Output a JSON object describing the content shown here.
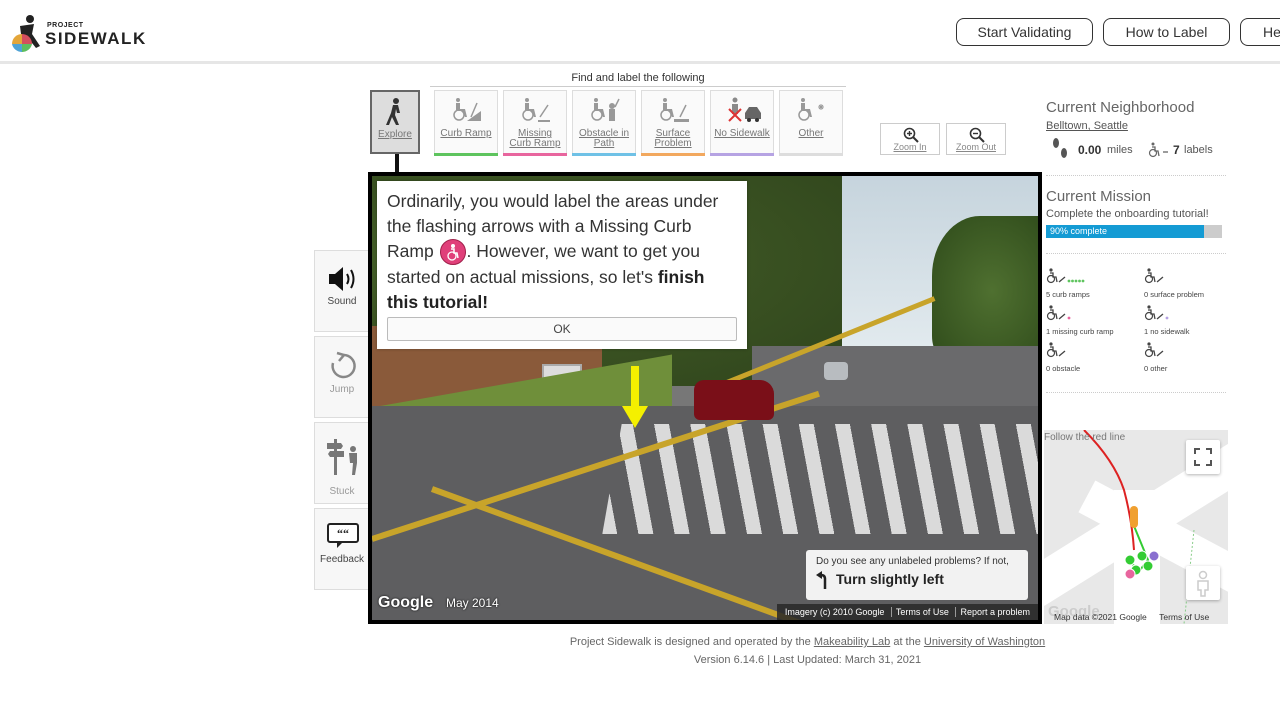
{
  "header": {
    "logo_small": "PROJECT",
    "logo_big": "SIDEWALK",
    "nav": [
      "Start Validating",
      "How to Label",
      "He"
    ]
  },
  "toolbar": {
    "find_label": "Find and label the following",
    "explore": "Explore",
    "tools": [
      {
        "label": "Curb Ramp",
        "color": "#5ec45e"
      },
      {
        "label": "Missing Curb Ramp",
        "line1": "Missing",
        "line2": "Curb Ramp",
        "color": "#e8659e"
      },
      {
        "label": "Obstacle in Path",
        "line1": "Obstacle in",
        "line2": "Path",
        "color": "#6fc1e6"
      },
      {
        "label": "Surface Problem",
        "line1": "Surface",
        "line2": "Problem",
        "color": "#f2a85e"
      },
      {
        "label": "No Sidewalk",
        "color": "#b6a3e3"
      },
      {
        "label": "Other",
        "color": "#dddddd"
      }
    ],
    "zoom_in": "Zoom In",
    "zoom_out": "Zoom Out"
  },
  "side_buttons": {
    "sound": "Sound",
    "jump": "Jump",
    "stuck": "Stuck",
    "feedback": "Feedback"
  },
  "tutorial": {
    "text_a": "Ordinarily, you would label the areas under the flashing arrows with a Missing Curb Ramp ",
    "text_b": ". However, we want to get you started on actual missions, so let's ",
    "text_bold": "finish this tutorial!",
    "ok": "OK",
    "icon": "missing-curb-ramp-icon"
  },
  "pano": {
    "google": "Google",
    "date": "May 2014",
    "hint_question": "Do you see any unlabeled problems? If not,",
    "hint_action": "Turn slightly left",
    "footer": [
      "Imagery (c) 2010 Google",
      "Terms of Use",
      "Report a problem"
    ]
  },
  "status": {
    "neighborhood_title": "Current Neighborhood",
    "neighborhood_name": "Belltown, Seattle",
    "distance_value": "0.00",
    "distance_unit": "miles",
    "labels_value": "7",
    "labels_unit": "labels",
    "mission_title": "Current Mission",
    "mission_desc": "Complete the onboarding tutorial!",
    "progress_percent": 90,
    "progress_text": "90% complete",
    "counts": [
      {
        "text": "5 curb ramps",
        "icon": "curb-ramp-icon",
        "dot": "#5ec45e"
      },
      {
        "text": "0 surface problem",
        "icon": "surface-problem-icon",
        "dot": "#f2a85e"
      },
      {
        "text": "1 missing curb ramp",
        "icon": "missing-curb-ramp-icon",
        "dot": "#e8659e"
      },
      {
        "text": "1 no sidewalk",
        "icon": "no-sidewalk-icon",
        "dot": "#b6a3e3"
      },
      {
        "text": "0 obstacle",
        "icon": "obstacle-icon",
        "dot": "#6fc1e6"
      },
      {
        "text": "0 other",
        "icon": "other-icon",
        "dot": "#dddddd"
      }
    ]
  },
  "minimap": {
    "label": "Follow the red line",
    "google": "Google",
    "footer_data": "Map data ©2021 Google",
    "footer_terms": "Terms of Use"
  },
  "footer": {
    "line1_a": "Project Sidewalk is designed and operated by the ",
    "line1_link1": "Makeability Lab",
    "line1_b": " at the ",
    "line1_link2": "University of Washington",
    "line2": "Version 6.14.6 | Last Updated: March 31, 2021"
  }
}
